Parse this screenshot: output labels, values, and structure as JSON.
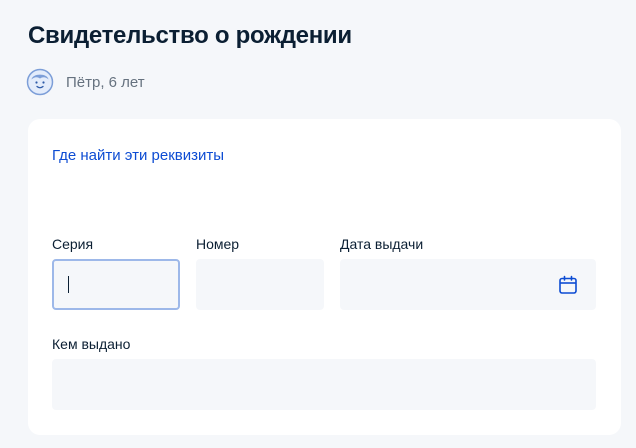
{
  "header": {
    "title": "Свидетельство о рождении"
  },
  "person": {
    "name": "Пётр, 6 лет",
    "icon": "child-avatar-icon"
  },
  "form": {
    "help_link": "Где найти эти реквизиты",
    "series": {
      "label": "Серия",
      "value": "",
      "placeholder": ""
    },
    "number": {
      "label": "Номер",
      "value": "",
      "placeholder": ""
    },
    "issue_date": {
      "label": "Дата выдачи",
      "value": "",
      "placeholder": "",
      "icon": "calendar-icon"
    },
    "issued_by": {
      "label": "Кем выдано",
      "value": "",
      "placeholder": ""
    }
  },
  "colors": {
    "accent": "#0d4cd3",
    "text_primary": "#0b1f33",
    "text_secondary": "#66727f",
    "field_bg": "#f5f7fa",
    "focus_border": "#9db8e9",
    "page_bg": "#f5f7fa",
    "card_bg": "#ffffff"
  }
}
